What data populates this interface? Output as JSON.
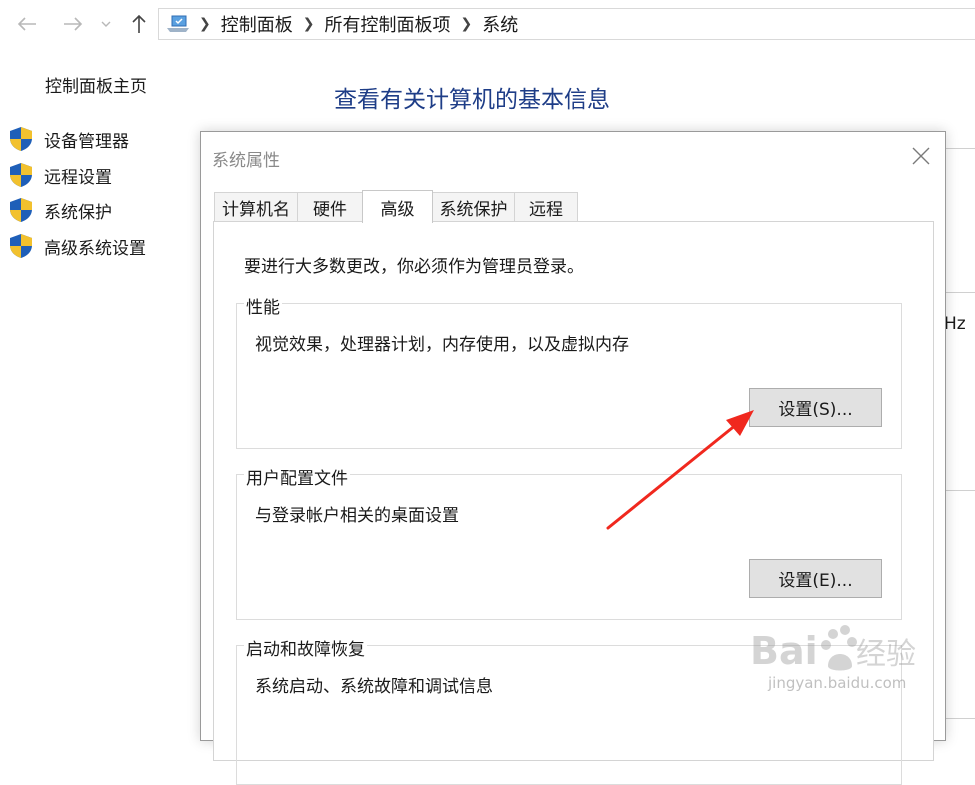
{
  "address_bar": {
    "crumbs": [
      "控制面板",
      "所有控制面板项",
      "系统"
    ]
  },
  "left_pane": {
    "home_link": "控制面板主页",
    "links": [
      {
        "label": "设备管理器",
        "icon": "shield-icon"
      },
      {
        "label": "远程设置",
        "icon": "shield-icon"
      },
      {
        "label": "系统保护",
        "icon": "shield-icon"
      },
      {
        "label": "高级系统设置",
        "icon": "shield-icon"
      }
    ]
  },
  "main": {
    "title": "查看有关计算机的基本信息",
    "partial_text": "Hz"
  },
  "dialog": {
    "title": "系统属性",
    "tabs": [
      "计算机名",
      "硬件",
      "高级",
      "系统保护",
      "远程"
    ],
    "active_tab": "高级",
    "admin_note": "要进行大多数更改，你必须作为管理员登录。",
    "groups": [
      {
        "legend": "性能",
        "description": "视觉效果，处理器计划，内存使用，以及虚拟内存",
        "button": "设置(S)..."
      },
      {
        "legend": "用户配置文件",
        "description": "与登录帐户相关的桌面设置",
        "button": "设置(E)..."
      },
      {
        "legend": "启动和故障恢复",
        "description": "系统启动、系统故障和调试信息"
      }
    ]
  },
  "annotation": {
    "color": "#f0281e"
  },
  "watermark": {
    "logo": "Baidu经验",
    "url": "jingyan.baidu.com"
  },
  "colors": {
    "title_blue": "#1e3d87",
    "shield_blue": "#1f5fb8",
    "shield_yellow": "#f2c12e"
  }
}
